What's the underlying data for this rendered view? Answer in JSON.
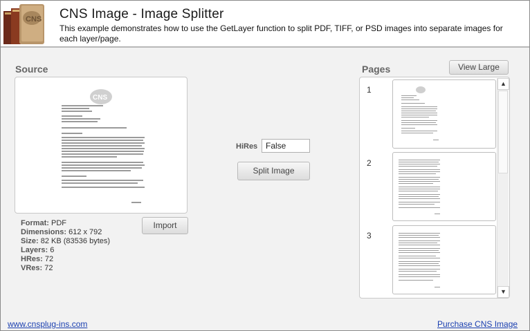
{
  "header": {
    "title": "CNS Image - Image Splitter",
    "subtitle": "This example demonstrates how to use the GetLayer function to split PDF, TIFF, or PSD images into separate images for each layer/page."
  },
  "source": {
    "section_title": "Source",
    "import_label": "Import",
    "info": {
      "format_label": "Format:",
      "format_value": "PDF",
      "dimensions_label": "Dimensions:",
      "dimensions_value": "612 x 792",
      "size_label": "Size:",
      "size_value": "82 KB (83536 bytes)",
      "layers_label": "Layers:",
      "layers_value": "6",
      "hres_label": "HRes:",
      "hres_value": "72",
      "vres_label": "VRes:",
      "vres_value": "72"
    }
  },
  "controls": {
    "hires_label": "HiRes",
    "hires_value": "False",
    "split_label": "Split Image"
  },
  "pages": {
    "section_title": "Pages",
    "view_large_label": "View Large",
    "items": [
      {
        "number": "1"
      },
      {
        "number": "2"
      },
      {
        "number": "3"
      }
    ]
  },
  "footer": {
    "left_link": "www.cnsplug-ins.com",
    "right_link": "Purchase CNS Image"
  },
  "icons": {
    "logo": "books-logo-icon",
    "scroll_up": "arrow-up-icon",
    "scroll_down": "arrow-down-icon"
  },
  "colors": {
    "link": "#1a3fb0",
    "section_title": "#666666",
    "background": "#f2f2f2"
  }
}
